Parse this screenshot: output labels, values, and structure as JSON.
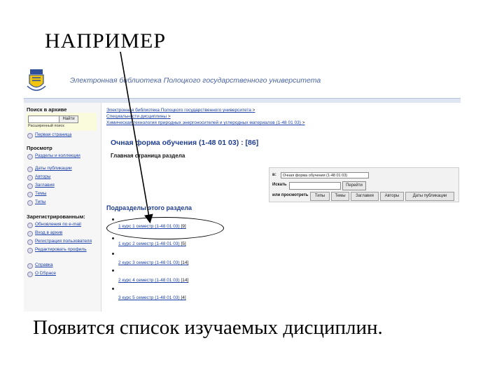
{
  "slide": {
    "heading": "НАПРИМЕР",
    "caption": "Появится список изучаемых дисциплин."
  },
  "site": {
    "title": "Электронная библиотека Полоцкого государственного университета"
  },
  "sidebar": {
    "search_section": "Поиск в архиве",
    "search_button": "Найти",
    "advanced_search": "Расширенный поиск",
    "home_link": "Первая страница",
    "browse_section": "Просмотр",
    "browse_items": [
      "Разделы и коллекции",
      "Даты публикации",
      "Авторы",
      "Заглавия",
      "Темы",
      "Типы"
    ],
    "registered_section": "Зарегистрированным:",
    "registered_items": [
      "Обновления по e-mail",
      "Вход в архив",
      "Регистрация пользователя",
      "Редактировать профиль"
    ],
    "extra_items": [
      "Справка",
      "О DSpace"
    ]
  },
  "breadcrumb": [
    "Электронная библиотека Полоцкого государственного университета",
    "Специальности дисциплины",
    "Химическая технология природных энергоносителей и углеродных материалов (1-48 01 03)"
  ],
  "breadcrumb_separator": ">",
  "section": {
    "title": "Очная форма обучения (1-48 01 03) : [86]",
    "subtitle": "Главная страница раздела"
  },
  "filter": {
    "in_label": "в:",
    "scope_value": "Очная форма обучения (1-48 01 03)",
    "search_label": "Искать",
    "go_button": "Перейти",
    "browse_label": "или просмотреть",
    "tabs": [
      "Типы",
      "Темы",
      "Заглавия",
      "Авторы",
      "Даты публикации"
    ]
  },
  "subsections": {
    "title": "Подразделы этого раздела",
    "items": [
      {
        "label": "1 курс 1 семестр (1-48 01 03)",
        "count": "[9]"
      },
      {
        "label": "1 курс 2 семестр (1-48 01 03)",
        "count": "[5]"
      },
      {
        "label": "2 курс 3 семестр (1-48 01 03)",
        "count": "[14]"
      },
      {
        "label": "2 курс 4 семестр (1-48 01 03)",
        "count": "[14]"
      },
      {
        "label": "3 курс 5 семестр (1-48 01 03)",
        "count": "[4]"
      }
    ]
  },
  "colors": {
    "link": "#1a3fa8",
    "title": "#1f3e8f",
    "header_band": "#dfe6f2",
    "sidebar_bg": "#f6f6f6",
    "search_box": "#fafadc"
  }
}
